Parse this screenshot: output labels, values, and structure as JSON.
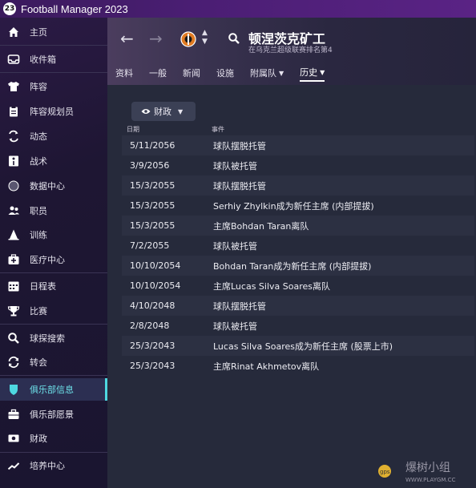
{
  "app": {
    "badge": "23",
    "title": "Football Manager 2023"
  },
  "sidebar": {
    "items": [
      {
        "label": "主页"
      },
      {
        "label": "收件箱"
      },
      {
        "label": "阵容"
      },
      {
        "label": "阵容规划员"
      },
      {
        "label": "动态"
      },
      {
        "label": "战术"
      },
      {
        "label": "数据中心"
      },
      {
        "label": "职员"
      },
      {
        "label": "训练"
      },
      {
        "label": "医疗中心"
      },
      {
        "label": "日程表"
      },
      {
        "label": "比赛"
      },
      {
        "label": "球探搜索"
      },
      {
        "label": "转会"
      },
      {
        "label": "俱乐部信息"
      },
      {
        "label": "俱乐部愿景"
      },
      {
        "label": "财政"
      },
      {
        "label": "培养中心"
      }
    ],
    "active_index": 14,
    "accent_color": "#4ed8e0"
  },
  "header": {
    "back_icon": "←",
    "forward_icon": "→",
    "club_name": "顿涅茨克矿工",
    "club_subtitle": "在乌克兰超级联赛排名第4",
    "tabs": [
      {
        "label": "资料",
        "dropdown": false
      },
      {
        "label": "一般",
        "dropdown": false
      },
      {
        "label": "新闻",
        "dropdown": false
      },
      {
        "label": "设施",
        "dropdown": false
      },
      {
        "label": "附属队",
        "dropdown": true
      },
      {
        "label": "历史",
        "dropdown": true
      }
    ],
    "active_tab": 5
  },
  "filter": {
    "label": "财政"
  },
  "table": {
    "headers": {
      "date": "日期",
      "event": "事件"
    },
    "rows": [
      {
        "date": "5/11/2056",
        "event": "球队摆脱托管"
      },
      {
        "date": "3/9/2056",
        "event": "球队被托管"
      },
      {
        "date": "15/3/2055",
        "event": "球队摆脱托管"
      },
      {
        "date": "15/3/2055",
        "event": "Serhiy Zhylkin成为新任主席 (内部提拔)"
      },
      {
        "date": "15/3/2055",
        "event": "主席Bohdan Taran离队"
      },
      {
        "date": "7/2/2055",
        "event": "球队被托管"
      },
      {
        "date": "10/10/2054",
        "event": "Bohdan Taran成为新任主席 (内部提拔)"
      },
      {
        "date": "10/10/2054",
        "event": "主席Lucas Silva Soares离队"
      },
      {
        "date": "4/10/2048",
        "event": "球队摆脱托管"
      },
      {
        "date": "2/8/2048",
        "event": "球队被托管"
      },
      {
        "date": "25/3/2043",
        "event": "Lucas Silva Soares成为新任主席 (股票上市)"
      },
      {
        "date": "25/3/2043",
        "event": "主席Rinat Akhmetov离队"
      }
    ]
  },
  "watermark": {
    "text": "爆树小组",
    "url": "WWW.PLAYGM.CC",
    "badge": "gps"
  }
}
